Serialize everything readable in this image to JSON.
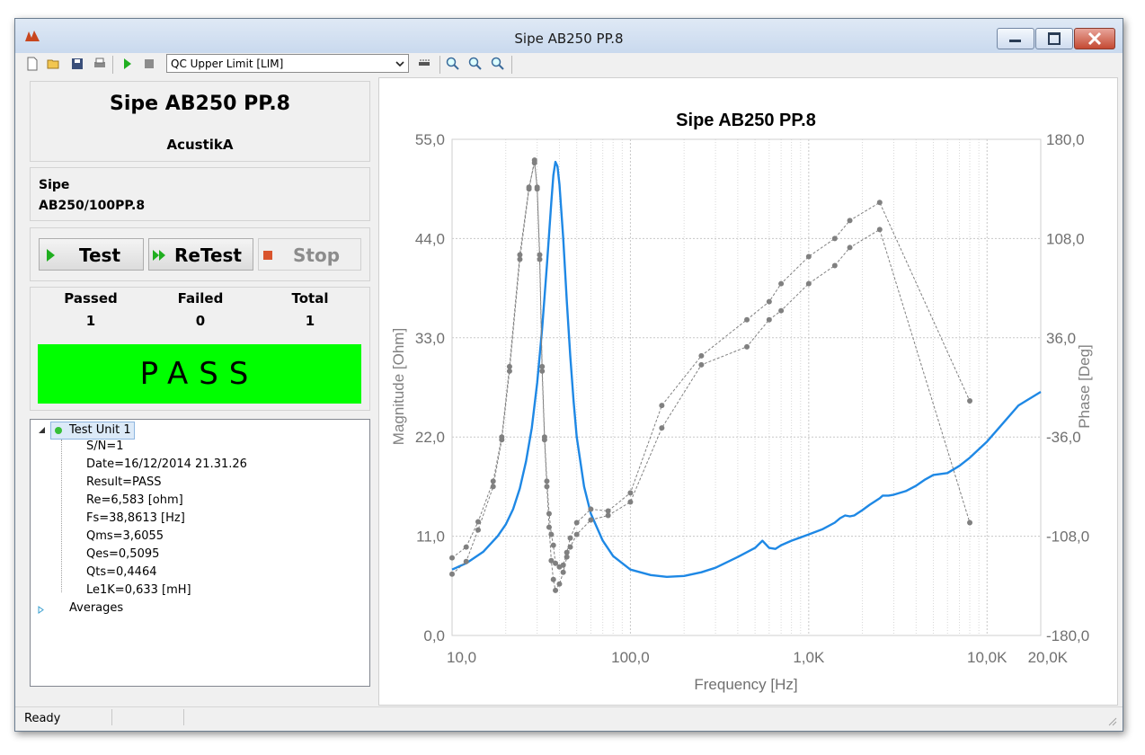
{
  "window": {
    "title": "Sipe AB250 PP.8"
  },
  "toolbar": {
    "limit_select": "QC Upper Limit [LIM]"
  },
  "header": {
    "title": "Sipe AB250 PP.8",
    "subtitle": "AcustikA"
  },
  "device": {
    "brand": "Sipe",
    "model": "AB250/100PP.8"
  },
  "buttons": {
    "test": "Test",
    "retest": "ReTest",
    "stop": "Stop"
  },
  "stats": {
    "passed_label": "Passed",
    "passed": "1",
    "failed_label": "Failed",
    "failed": "0",
    "total_label": "Total",
    "total": "1"
  },
  "result_banner": "PASS",
  "tree": {
    "root": "Test Unit 1",
    "children": [
      "S/N=1",
      "Date=16/12/2014 21.31.26",
      "Result=PASS",
      "Re=6,583 [ohm]",
      "Fs=38,8613 [Hz]",
      "Qms=3,6055",
      "Qes=0,5095",
      "Qts=0,4464",
      "Le1K=0,633 [mH]"
    ],
    "averages": "Averages"
  },
  "status_bar": {
    "text": "Ready"
  },
  "colors": {
    "pass": "#00ff00",
    "curve": "#1e88e5",
    "limits": "#808080"
  },
  "chart_data": {
    "type": "line",
    "title": "Sipe AB250 PP.8",
    "xlabel": "Frequency [Hz]",
    "ylabel": "Magnitude  [Ohm]",
    "y2label": "Phase  [Deg]",
    "xscale": "log",
    "xlim": [
      10,
      20000
    ],
    "ylim": [
      0,
      55
    ],
    "y2lim": [
      -180,
      180
    ],
    "xticklabels": [
      "10,0",
      "100,0",
      "1,0K",
      "10,0K",
      "20,0K"
    ],
    "xtickvalues": [
      10,
      100,
      1000,
      10000,
      20000
    ],
    "yticklabels": [
      "0,0",
      "11,0",
      "22,0",
      "33,0",
      "44,0",
      "55,0"
    ],
    "y2ticklabels": [
      "-180,0",
      "-108,0",
      "-36,0",
      "36,0",
      "108,0",
      "180,0"
    ],
    "grid": true,
    "series": [
      {
        "role": "measured",
        "x": [
          10,
          12,
          15,
          18,
          20,
          22,
          24,
          26,
          28,
          30,
          32,
          34,
          36,
          37,
          38,
          39,
          40,
          42,
          44,
          46,
          48,
          50,
          55,
          60,
          70,
          80,
          100,
          130,
          160,
          200,
          250,
          300,
          400,
          500,
          550,
          600,
          650,
          700,
          800,
          1000,
          1200,
          1400,
          1500,
          1600,
          1700,
          1800,
          2000,
          2200,
          2500,
          2600,
          2800,
          3000,
          3500,
          4000,
          4500,
          5000,
          6000,
          7000,
          8000,
          10000,
          12000,
          15000,
          20000
        ],
        "y": [
          7.3,
          8.0,
          9.3,
          11.0,
          12.3,
          14.0,
          16.3,
          19.3,
          23.0,
          28.0,
          34.0,
          41.0,
          48.0,
          51.0,
          52.5,
          52.0,
          50.0,
          44.0,
          37.0,
          31.0,
          26.0,
          22.0,
          16.5,
          13.5,
          10.5,
          8.8,
          7.3,
          6.7,
          6.5,
          6.6,
          7.0,
          7.5,
          8.7,
          9.7,
          10.5,
          9.7,
          9.6,
          10.0,
          10.5,
          11.2,
          11.8,
          12.5,
          13.0,
          13.3,
          13.2,
          13.3,
          13.9,
          14.5,
          15.2,
          15.5,
          15.5,
          15.6,
          16.0,
          16.6,
          17.3,
          17.8,
          18.0,
          18.8,
          19.7,
          21.5,
          23.3,
          25.5,
          27.0
        ]
      },
      {
        "role": "upper-limit",
        "x": [
          10,
          12,
          14,
          17,
          19,
          21,
          24,
          27,
          29,
          30,
          31,
          32,
          33,
          34,
          35,
          36,
          37,
          38,
          40,
          42,
          44,
          46,
          50,
          60,
          75,
          100,
          150,
          250,
          450,
          600,
          700,
          1000,
          1400,
          1700,
          2500,
          8000
        ],
        "y": [
          8.6,
          9.8,
          12.6,
          17.1,
          22.0,
          29.8,
          42.2,
          49.7,
          52.4,
          49.7,
          42.2,
          29.8,
          22.0,
          17.1,
          13.5,
          11.2,
          10.0,
          8.0,
          7.6,
          7.8,
          9.2,
          10.8,
          12.5,
          14.0,
          13.8,
          15.8,
          25.5,
          31.0,
          35.0,
          37.0,
          39.0,
          42.0,
          44.0,
          46.0,
          48.0,
          26.0
        ]
      },
      {
        "role": "lower-limit",
        "x": [
          10,
          12,
          14,
          17,
          19,
          21,
          24,
          27,
          29,
          30,
          31,
          32,
          33,
          34,
          35,
          36,
          37,
          38,
          40,
          42,
          44,
          46,
          50,
          60,
          75,
          100,
          150,
          250,
          450,
          600,
          700,
          1000,
          1400,
          1700,
          2500,
          8000
        ],
        "y": [
          6.8,
          8.2,
          11.7,
          16.5,
          21.7,
          29.3,
          41.7,
          49.5,
          52.7,
          49.5,
          41.7,
          29.3,
          21.7,
          16.5,
          12.0,
          8.3,
          6.2,
          5.0,
          5.7,
          7.0,
          8.7,
          9.8,
          11.2,
          12.8,
          13.3,
          14.8,
          23.0,
          30.0,
          32.0,
          35.0,
          36.0,
          39.0,
          41.0,
          43.0,
          45.0,
          12.5
        ]
      }
    ]
  }
}
